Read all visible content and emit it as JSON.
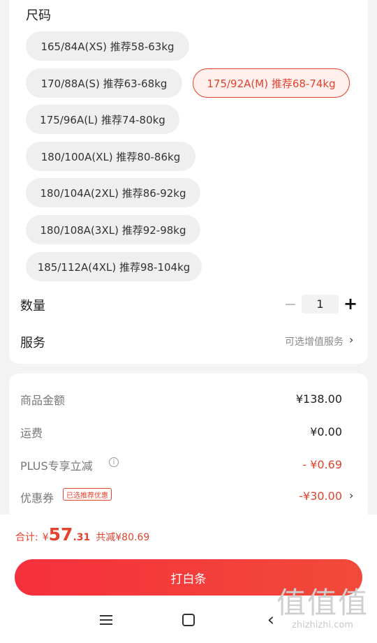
{
  "size_section": {
    "title": "尺码",
    "options": [
      {
        "label": "165/84A(XS) 推荐58-63kg",
        "selected": false
      },
      {
        "label": "170/88A(S) 推荐63-68kg",
        "selected": false
      },
      {
        "label": "175/92A(M) 推荐68-74kg",
        "selected": true
      },
      {
        "label": "175/96A(L) 推荐74-80kg",
        "selected": false
      },
      {
        "label": "180/100A(XL) 推荐80-86kg",
        "selected": false
      },
      {
        "label": "180/104A(2XL) 推荐86-92kg",
        "selected": false
      },
      {
        "label": "180/108A(3XL) 推荐92-98kg",
        "selected": false
      },
      {
        "label": "185/112A(4XL) 推荐98-104kg",
        "selected": false
      }
    ]
  },
  "quantity": {
    "label": "数量",
    "minus": "−",
    "value": "1",
    "plus": "+"
  },
  "service": {
    "label": "服务",
    "hint": "可选增值服务",
    "chevron": "›"
  },
  "fees": {
    "goods_label": "商品金额",
    "goods_value": "¥138.00",
    "shipping_label": "运费",
    "shipping_value": "¥0.00",
    "plus_label": "PLUS专享立减",
    "plus_info": "i",
    "plus_value": "- ¥0.69",
    "coupon_label": "优惠券",
    "coupon_tag": "已选推荐优惠",
    "coupon_value": "-¥30.00",
    "coupon_chevron": "›"
  },
  "total": {
    "label": "合计:",
    "currency": "¥",
    "amount_int": "57",
    "amount_dec": ".31",
    "saved": "共减¥80.69"
  },
  "pay_button": "打白条",
  "nav": {
    "back": "‹"
  },
  "watermark": {
    "glyphs": "值值值",
    "site": "zhizhizhi.com"
  },
  "colors": {
    "accent": "#e2432f",
    "button": "#f5303c"
  }
}
